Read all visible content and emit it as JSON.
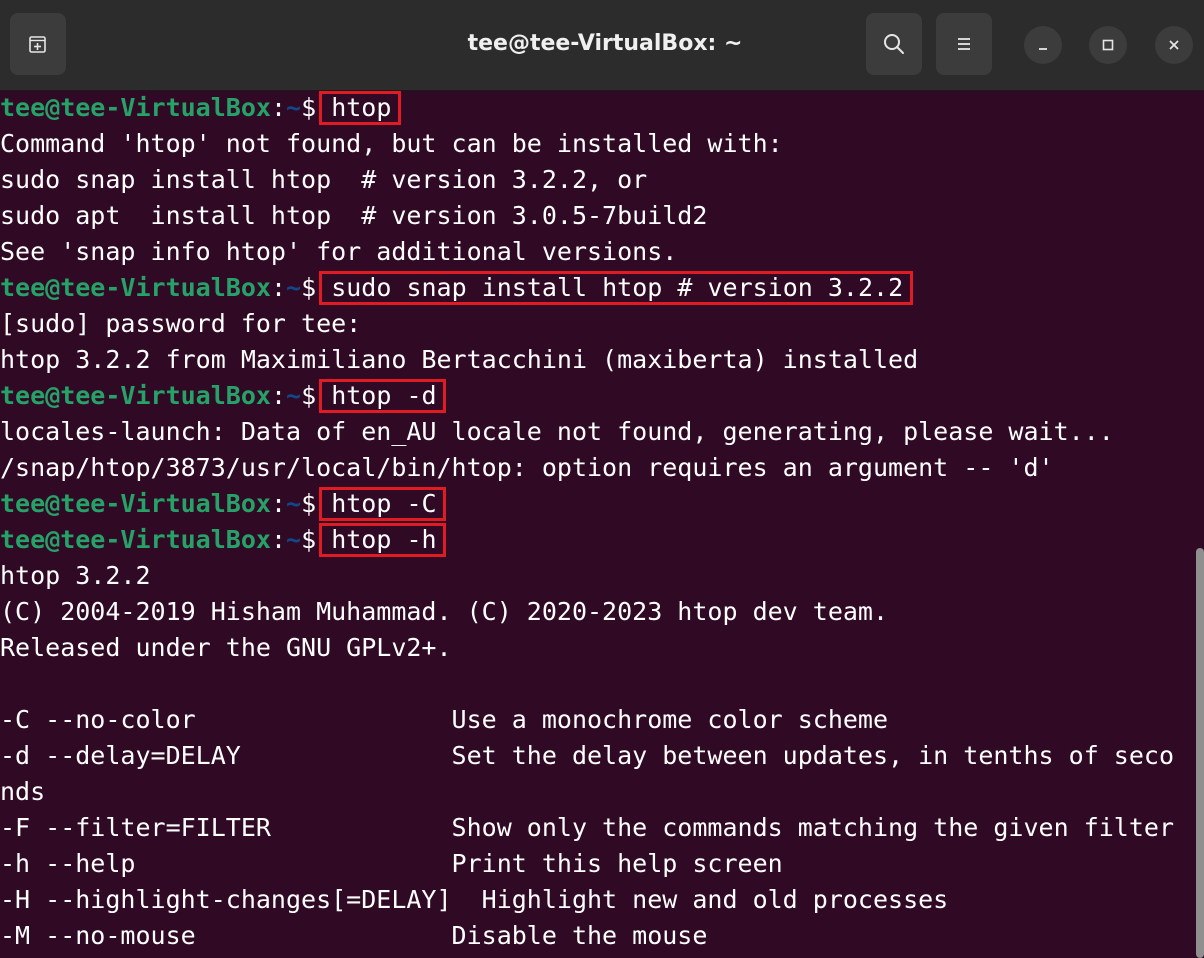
{
  "window": {
    "title": "tee@tee-VirtualBox: ~"
  },
  "icons": {
    "new_tab": "new-tab-icon",
    "search": "search-icon",
    "menu": "hamburger-menu-icon",
    "minimize": "minimize-icon",
    "maximize": "maximize-icon",
    "close": "close-icon"
  },
  "colors": {
    "terminal_bg": "#300a24",
    "titlebar_bg": "#2c2c2c",
    "prompt_user": "#26a269",
    "prompt_path": "#12488b",
    "highlight_box": "#e01b24"
  },
  "prompt": {
    "user": "tee@tee-VirtualBox",
    "separator": ":",
    "path": "~",
    "symbol": "$"
  },
  "terminal": {
    "lines": [
      {
        "type": "prompt",
        "command": "htop"
      },
      {
        "type": "output",
        "text": "Command 'htop' not found, but can be installed with:"
      },
      {
        "type": "output",
        "text": "sudo snap install htop  # version 3.2.2, or"
      },
      {
        "type": "output",
        "text": "sudo apt  install htop  # version 3.0.5-7build2"
      },
      {
        "type": "output",
        "text": "See 'snap info htop' for additional versions."
      },
      {
        "type": "prompt",
        "command": "sudo snap install htop # version 3.2.2"
      },
      {
        "type": "output",
        "text": "[sudo] password for tee:"
      },
      {
        "type": "output",
        "text": "htop 3.2.2 from Maximiliano Bertacchini (maxiberta) installed"
      },
      {
        "type": "prompt",
        "command": "htop -d"
      },
      {
        "type": "output",
        "text": "locales-launch: Data of en_AU locale not found, generating, please wait..."
      },
      {
        "type": "output",
        "text": "/snap/htop/3873/usr/local/bin/htop: option requires an argument -- 'd'"
      },
      {
        "type": "prompt",
        "command": "htop -C"
      },
      {
        "type": "prompt",
        "command": "htop -h"
      },
      {
        "type": "output",
        "text": "htop 3.2.2"
      },
      {
        "type": "output",
        "text": "(C) 2004-2019 Hisham Muhammad. (C) 2020-2023 htop dev team."
      },
      {
        "type": "output",
        "text": "Released under the GNU GPLv2+."
      },
      {
        "type": "output",
        "text": ""
      },
      {
        "type": "output",
        "text": "-C --no-color                 Use a monochrome color scheme"
      },
      {
        "type": "output",
        "text": "-d --delay=DELAY              Set the delay between updates, in tenths of seco"
      },
      {
        "type": "output",
        "text": "nds"
      },
      {
        "type": "output",
        "text": "-F --filter=FILTER            Show only the commands matching the given filter"
      },
      {
        "type": "output",
        "text": "-h --help                     Print this help screen"
      },
      {
        "type": "output",
        "text": "-H --highlight-changes[=DELAY]  Highlight new and old processes"
      },
      {
        "type": "output",
        "text": "-M --no-mouse                 Disable the mouse"
      }
    ]
  }
}
